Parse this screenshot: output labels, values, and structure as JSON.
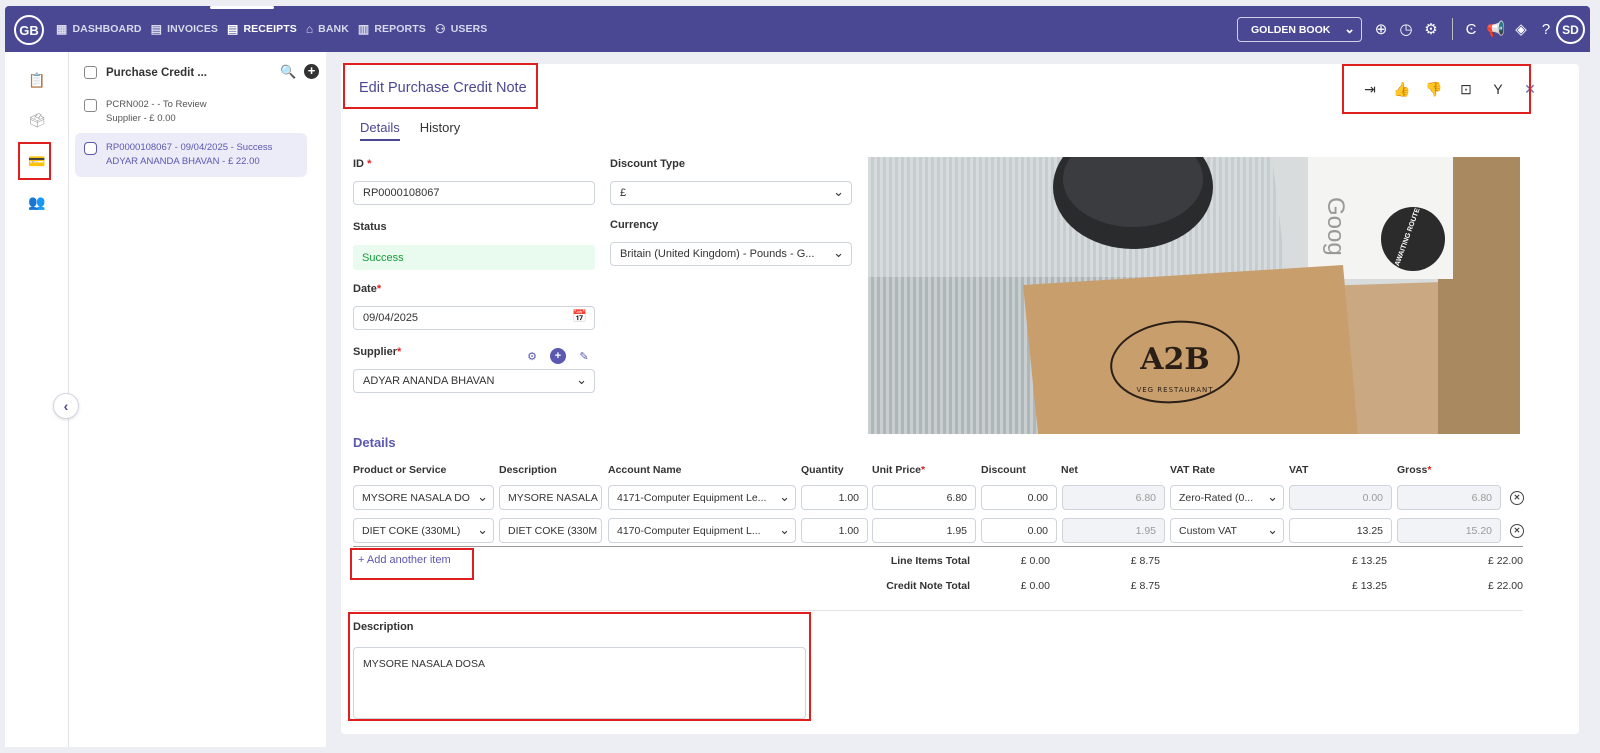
{
  "app": {
    "logo": "GB",
    "nav": [
      {
        "label": "DASHBOARD",
        "icon": "grid-icon"
      },
      {
        "label": "INVOICES",
        "icon": "invoice-icon"
      },
      {
        "label": "RECEIPTS",
        "icon": "receipt-icon"
      },
      {
        "label": "BANK",
        "icon": "bank-icon"
      },
      {
        "label": "REPORTS",
        "icon": "reports-icon"
      },
      {
        "label": "USERS",
        "icon": "users-icon"
      }
    ],
    "company": "GOLDEN BOOK",
    "avatar": "SD",
    "accent": "#4a4893"
  },
  "list": {
    "title": "Purchase Credit ...",
    "items": [
      {
        "line1": "PCRN002 -  - To Review",
        "line2": "Supplier - £ 0.00"
      },
      {
        "line1": "RP0000108067 - 09/04/2025 - Success",
        "line2": "ADYAR ANANDA BHAVAN - £ 22.00"
      }
    ]
  },
  "form": {
    "title": "Edit Purchase Credit Note",
    "tabs": [
      "Details",
      "History"
    ],
    "id_label": "ID",
    "id_value": "RP0000108067",
    "status_label": "Status",
    "status_value": "Success",
    "date_label": "Date",
    "date_value": "09/04/2025",
    "supplier_label": "Supplier",
    "supplier_value": "ADYAR ANANDA BHAVAN",
    "discount_type_label": "Discount Type",
    "discount_type_value": "£",
    "currency_label": "Currency",
    "currency_value": "Britain (United Kingdom) - Pounds - G..."
  },
  "details": {
    "title": "Details",
    "headers": [
      "Product or Service",
      "Description",
      "Account Name",
      "Quantity",
      "Unit Price",
      "Discount",
      "Net",
      "VAT Rate",
      "VAT",
      "Gross"
    ],
    "rows": [
      {
        "product": "MYSORE NASALA DO",
        "description": "MYSORE NASALA",
        "account": "4171-Computer Equipment Le...",
        "quantity": "1.00",
        "unit_price": "6.80",
        "discount": "0.00",
        "net": "6.80",
        "vat_rate": "Zero-Rated (0...",
        "vat": "0.00",
        "gross": "6.80"
      },
      {
        "product": "DIET COKE (330ML)",
        "description": "DIET COKE (330M",
        "account": "4170-Computer Equipment L...",
        "quantity": "1.00",
        "unit_price": "1.95",
        "discount": "0.00",
        "net": "1.95",
        "vat_rate": "Custom VAT",
        "vat": "13.25",
        "gross": "15.20"
      }
    ],
    "add_item": "+ Add another item",
    "totals": [
      {
        "label": "Line Items Total",
        "discount": "£ 0.00",
        "net": "£ 8.75",
        "vat": "£ 13.25",
        "gross": "£ 22.00"
      },
      {
        "label": "Credit Note Total",
        "discount": "£ 0.00",
        "net": "£ 8.75",
        "vat": "£ 13.25",
        "gross": "£ 22.00"
      }
    ]
  },
  "description": {
    "label": "Description",
    "value": "MYSORE NASALA DOSA"
  },
  "receipt_image": {
    "logo_text": "A2B",
    "sub_text": "VEG RESTAURANT",
    "sticker": "AWAITING ROUTE",
    "card_text": "Goog"
  }
}
